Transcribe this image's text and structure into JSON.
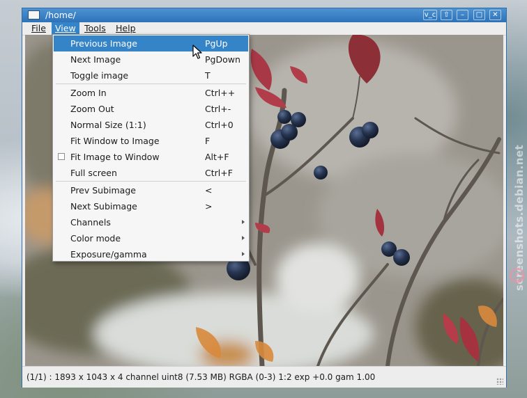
{
  "window": {
    "title": "/home/",
    "title_buttons": {
      "extra": "v_c",
      "up": "⇧",
      "minimize": "–",
      "maximize": "□",
      "close": "✕"
    }
  },
  "menubar": [
    "File",
    "View",
    "Tools",
    "Help"
  ],
  "view_menu": {
    "items": [
      {
        "label": "Previous Image",
        "shortcut": "PgUp",
        "highlighted": true
      },
      {
        "label": "Next Image",
        "shortcut": "PgDown"
      },
      {
        "label": "Toggle image",
        "shortcut": "T"
      },
      {
        "label": "Zoom In",
        "shortcut": "Ctrl++"
      },
      {
        "label": "Zoom Out",
        "shortcut": "Ctrl+-"
      },
      {
        "label": "Normal Size (1:1)",
        "shortcut": "Ctrl+0"
      },
      {
        "label": "Fit Window to Image",
        "shortcut": "F"
      },
      {
        "label": "Fit Image to Window",
        "shortcut": "Alt+F",
        "checkbox": true,
        "checked": false
      },
      {
        "label": "Full screen",
        "shortcut": "Ctrl+F"
      },
      {
        "label": "Prev Subimage",
        "shortcut": "<"
      },
      {
        "label": "Next Subimage",
        "shortcut": ">"
      },
      {
        "label": "Channels",
        "shortcut": "",
        "submenu": true
      },
      {
        "label": "Color mode",
        "shortcut": "",
        "submenu": true
      },
      {
        "label": "Exposure/gamma",
        "shortcut": "",
        "submenu": true
      }
    ]
  },
  "status": {
    "text": "(1/1) : 1893 x 1043 x 4 channel uint8 (7.53 MB)  RGBA (0-3)  1:2  exp +0.0  gam 1.00"
  },
  "watermark": "screenshots.debian.net",
  "colors": {
    "accent": "#3584c7",
    "titlebar": "#2d72b8"
  }
}
